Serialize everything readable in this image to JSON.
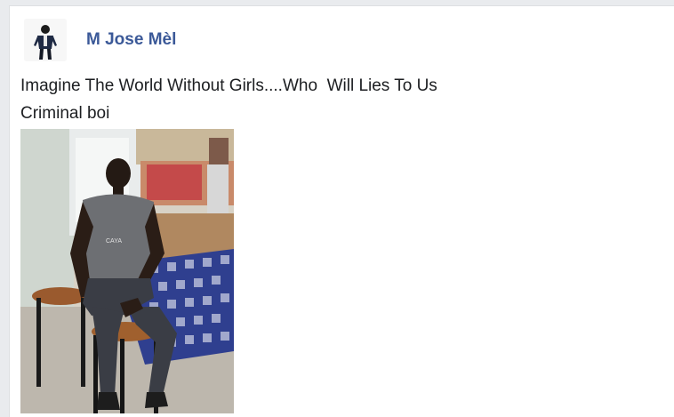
{
  "post": {
    "author_name": "M Jose Mèl",
    "text_line1": "Imagine The World Without Girls....Who  Will Lies To Us",
    "text_line2": "Criminal boi",
    "shirt_text": "CAYA"
  },
  "colors": {
    "author_link": "#3b5998",
    "text": "#1c1e21",
    "card_bg": "#ffffff",
    "page_bg": "#e9ebee"
  },
  "icons": {
    "avatar": "profile-photo",
    "photo": "post-photo"
  }
}
